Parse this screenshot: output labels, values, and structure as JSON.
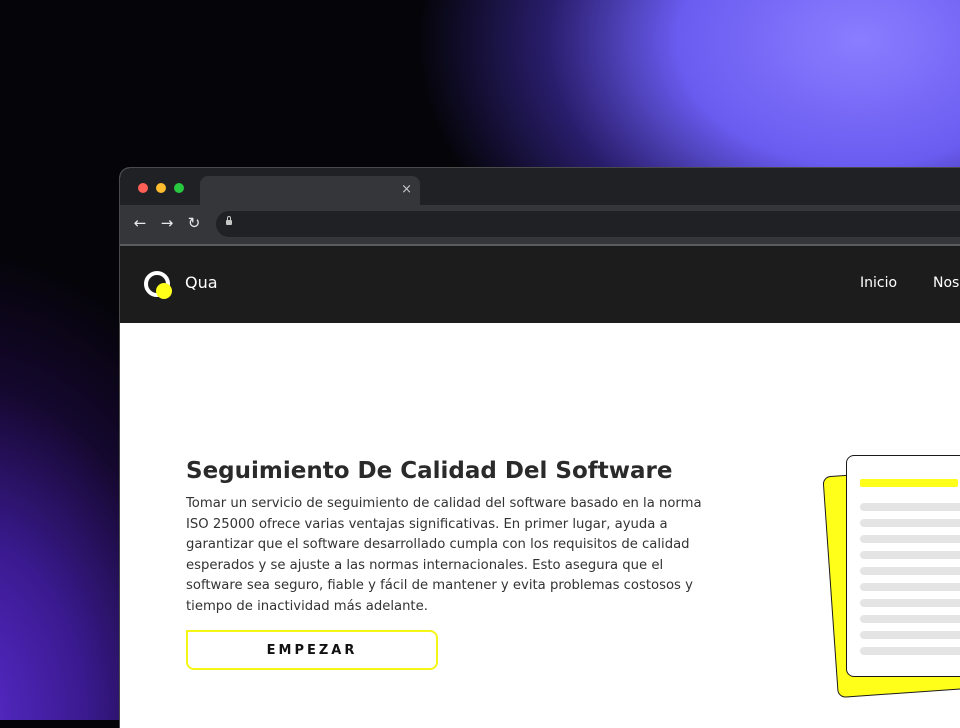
{
  "browser": {
    "tab": {
      "title": "",
      "close_symbol": "×"
    },
    "toolbar": {
      "back_symbol": "←",
      "forward_symbol": "→",
      "reload_symbol": "↻",
      "url": ""
    }
  },
  "site": {
    "brand": "Qua",
    "nav": {
      "inicio": "Inicio",
      "nosotros_partial": "Nos"
    }
  },
  "hero": {
    "title": "Seguimiento De Calidad Del Software",
    "body": "Tomar un servicio de seguimiento de calidad del software basado en la norma ISO 25000 ofrece varias ventajas significativas. En primer lugar, ayuda a garantizar que el software desarrollado cumpla con los requisitos de calidad esperados y se ajuste a las normas internacionales. Esto asegura que el software sea seguro, fiable y fácil de mantener y evita problemas costosos y tiempo de inactividad más adelante.",
    "cta_label": "EMPEZAR"
  },
  "colors": {
    "accent_yellow": "#ffff1a",
    "header_bg": "#1c1c1c",
    "browser_chrome": "#35363a"
  },
  "icons": [
    "close-icon",
    "back-arrow-icon",
    "forward-arrow-icon",
    "reload-icon",
    "lock-icon",
    "logo-icon",
    "document-illustration"
  ]
}
